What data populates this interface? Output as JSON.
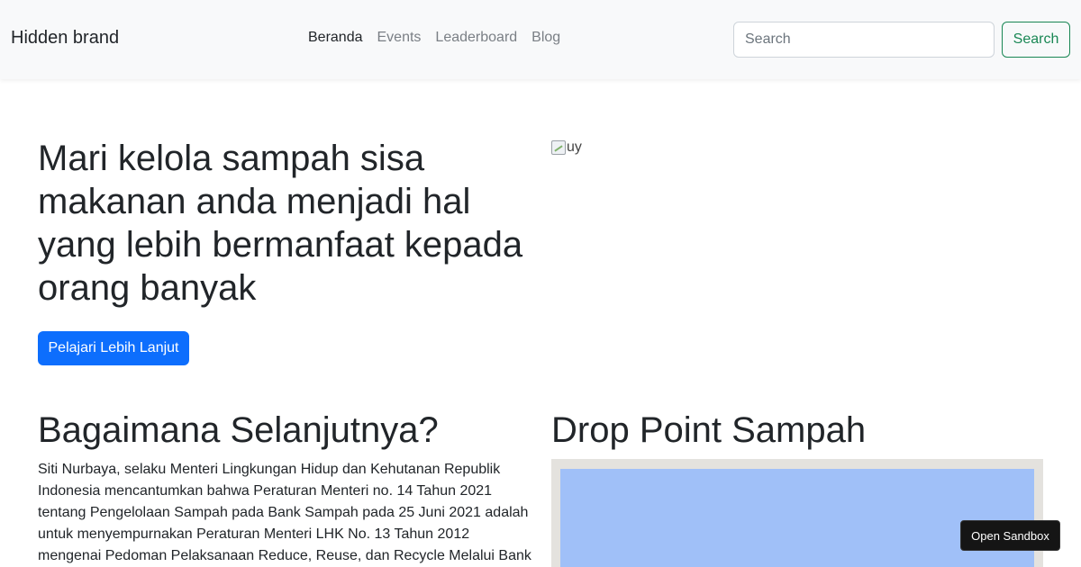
{
  "navbar": {
    "brand": "Hidden brand",
    "links": [
      {
        "label": "Beranda",
        "active": true
      },
      {
        "label": "Events",
        "active": false
      },
      {
        "label": "Leaderboard",
        "active": false
      },
      {
        "label": "Blog",
        "active": false
      }
    ],
    "search": {
      "placeholder": "Search",
      "value": ""
    },
    "search_button": "Search"
  },
  "hero": {
    "title": "Mari kelola sampah sisa makanan anda menjadi hal yang lebih bermanfaat kepada orang banyak",
    "button": "Pelajari Lebih Lanjut",
    "image_alt": "uy"
  },
  "next_section": {
    "title": "Bagaimana Selanjutnya?",
    "text": "Siti Nurbaya, selaku Menteri Lingkungan Hidup dan Kehutanan Republik Indonesia mencantumkan bahwa Peraturan Menteri no. 14 Tahun 2021 tentang Pengelolaan Sampah pada Bank Sampah pada 25 Juni 2021 adalah untuk menyempurnakan Peraturan Menteri LHK No. 13 Tahun 2012 mengenai Pedoman Pelaksanaan Reduce, Reuse, dan Recycle Melalui Bank Sampah."
  },
  "drop_point": {
    "title": "Drop Point Sampah"
  },
  "sandbox_button": "Open Sandbox",
  "colors": {
    "primary": "#0d6efd",
    "success": "#198754",
    "navbar_bg": "#f8f9fa",
    "map_water": "#a0c0f8"
  }
}
